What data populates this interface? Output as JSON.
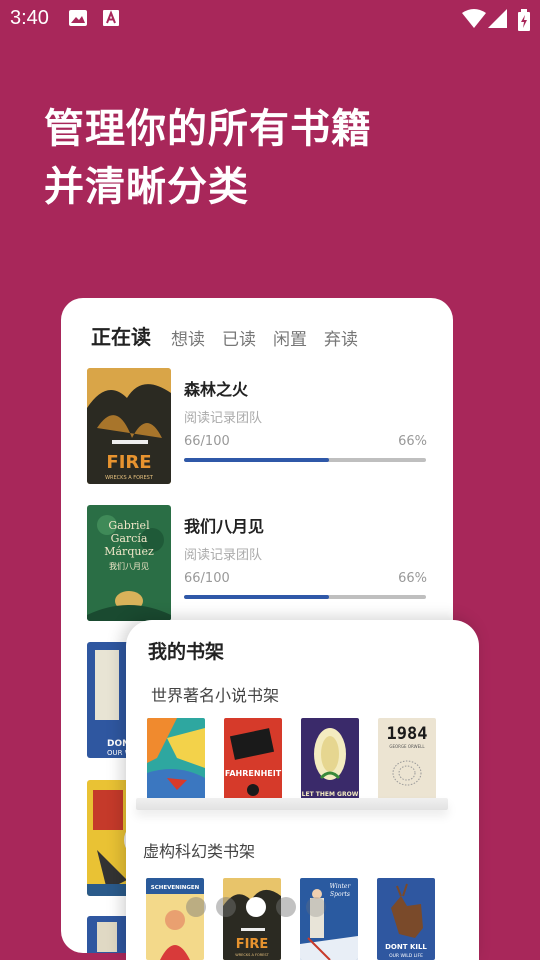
{
  "status_bar": {
    "time": "3:40"
  },
  "headline": {
    "line1": "管理你的所有书籍",
    "line2": "并清晰分类"
  },
  "reading_card": {
    "tabs": [
      "正在读",
      "想读",
      "已读",
      "闲置",
      "弃读"
    ],
    "active_tab": "正在读",
    "books": [
      {
        "title": "森林之火",
        "author": "阅读记录团队",
        "progress": "66/100",
        "percent": "66%",
        "fraction": 0.6
      },
      {
        "title": "我们八月见",
        "author": "阅读记录团队",
        "progress": "66/100",
        "percent": "66%",
        "fraction": 0.6
      }
    ]
  },
  "shelf_card": {
    "title": "我的书架",
    "shelves": [
      {
        "name": "世界著名小说书架"
      },
      {
        "name": "虚构科幻类书架"
      }
    ]
  },
  "covers": {
    "fire": {
      "big": "FIRE",
      "small": "WRECKS A FOREST"
    },
    "marquez": {
      "line1": "Gabriel",
      "line2": "García",
      "line3": "Márquez",
      "cn": "我们八月见"
    },
    "fahrenheit": "FAHRENHEIT",
    "let_them_grow": "LET THEM GROW",
    "nineteen84": {
      "big": "1984",
      "small": "GEORGE ORWELL"
    },
    "scheveningen": "SCHEVENINGEN",
    "winter_sports": {
      "line1": "Winter",
      "line2": "Sports"
    },
    "dont_kill": {
      "line1": "DONT KILL",
      "line2": "OUR WILD LIFE"
    }
  },
  "pager": {
    "count": 5,
    "active_index": 2
  },
  "colors": {
    "background": "#a8275a",
    "progress_fill": "#2f58a8",
    "progress_track": "#bfbfbf"
  }
}
